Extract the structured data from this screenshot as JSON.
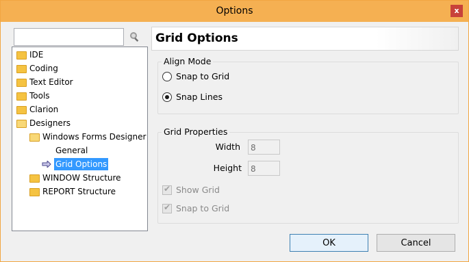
{
  "window": {
    "title": "Options",
    "close_glyph": "x"
  },
  "search": {
    "value": "",
    "placeholder": "",
    "icon": "search-icon"
  },
  "tree": {
    "items": [
      {
        "label": "IDE",
        "icon": "folder-icon"
      },
      {
        "label": "Coding",
        "icon": "folder-icon"
      },
      {
        "label": "Text Editor",
        "icon": "folder-icon"
      },
      {
        "label": "Tools",
        "icon": "folder-icon"
      },
      {
        "label": "Clarion",
        "icon": "folder-icon"
      },
      {
        "label": "Designers",
        "icon": "folder-open-icon"
      },
      {
        "label": "Windows Forms Designer",
        "icon": "folder-open-icon"
      },
      {
        "label": "General",
        "icon": ""
      },
      {
        "label": "Grid Options",
        "icon": "arrow-right-icon",
        "selected": true
      },
      {
        "label": "WINDOW Structure",
        "icon": "folder-icon"
      },
      {
        "label": "REPORT Structure",
        "icon": "folder-icon"
      }
    ]
  },
  "panel": {
    "title": "Grid Options",
    "align_mode": {
      "label": "Align Mode",
      "options": [
        {
          "label": "Snap to Grid",
          "checked": false
        },
        {
          "label": "Snap Lines",
          "checked": true
        }
      ]
    },
    "grid_properties": {
      "label": "Grid Properties",
      "width_label": "Width",
      "width_value": "8",
      "height_label": "Height",
      "height_value": "8",
      "show_grid_label": "Show Grid",
      "show_grid_checked": true,
      "snap_to_grid_label": "Snap to Grid",
      "snap_to_grid_checked": true
    }
  },
  "buttons": {
    "ok": "OK",
    "cancel": "Cancel"
  },
  "colors": {
    "titlebar": "#f5b052",
    "selection": "#3399ff",
    "close": "#c8423a"
  }
}
